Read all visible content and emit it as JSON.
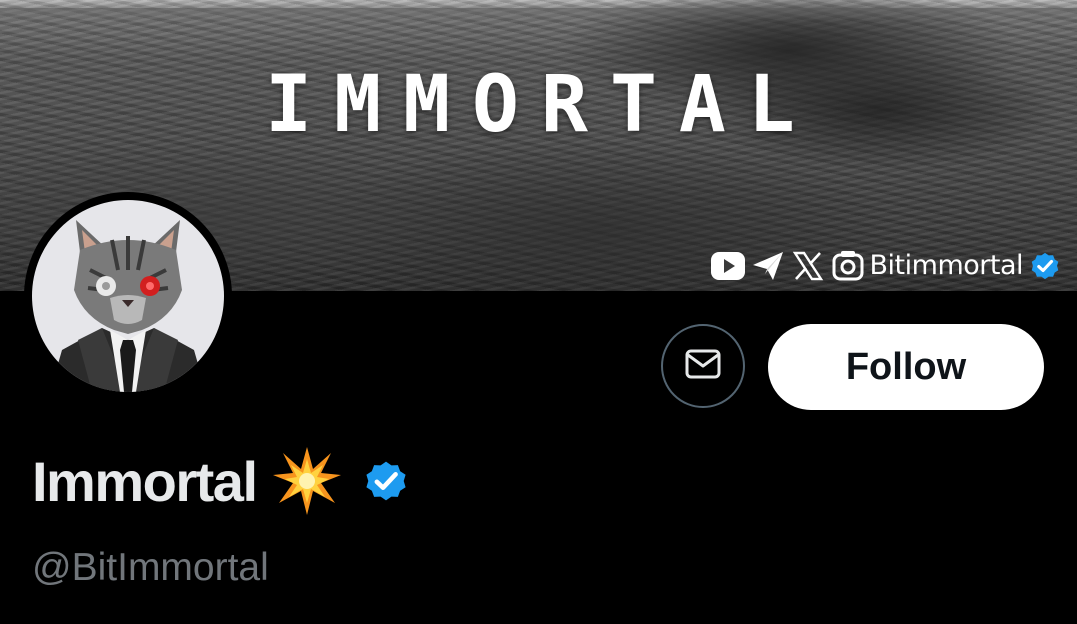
{
  "banner": {
    "title": "IMMORTAL",
    "social": {
      "icons": [
        "youtube-icon",
        "telegram-icon",
        "x-logo-icon",
        "instagram-icon"
      ],
      "handle": "Bitimmortal",
      "verified": true
    }
  },
  "profile": {
    "display_name": "Immortal",
    "name_emoji": "collision-emoji",
    "verified": true,
    "handle": "@BitImmortal"
  },
  "actions": {
    "follow_label": "Follow",
    "message_icon": "envelope-icon"
  },
  "colors": {
    "background": "#000000",
    "verified_blue": "#1d9bf0",
    "follow_bg": "#ffffff",
    "follow_text": "#0f1419",
    "handle_gray": "#71767b",
    "button_border": "#536471"
  }
}
